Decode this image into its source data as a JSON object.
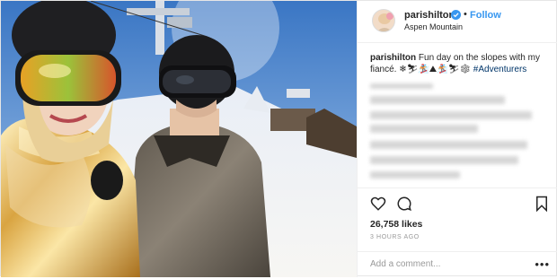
{
  "header": {
    "username": "parishilton",
    "follow_label": "Follow",
    "location": "Aspen Mountain",
    "separator": "•"
  },
  "caption": {
    "username": "parishilton",
    "text": "Fun day on the slopes with my fiancé. ❄⛷🏂⛰🏂⛷❄ ",
    "hashtag": "#Adventurers"
  },
  "post": {
    "likes": "26,758 likes",
    "time": "3 HOURS AGO"
  },
  "comment": {
    "placeholder": "Add a comment...",
    "more_icon": "•••"
  },
  "colors": {
    "link": "#3897f0",
    "hashtag": "#003569",
    "text": "#262626",
    "muted": "#999999",
    "verified": "#3897f0"
  },
  "icons": [
    "verified-badge-icon",
    "heart-icon",
    "comment-icon",
    "bookmark-icon",
    "more-options-icon"
  ]
}
